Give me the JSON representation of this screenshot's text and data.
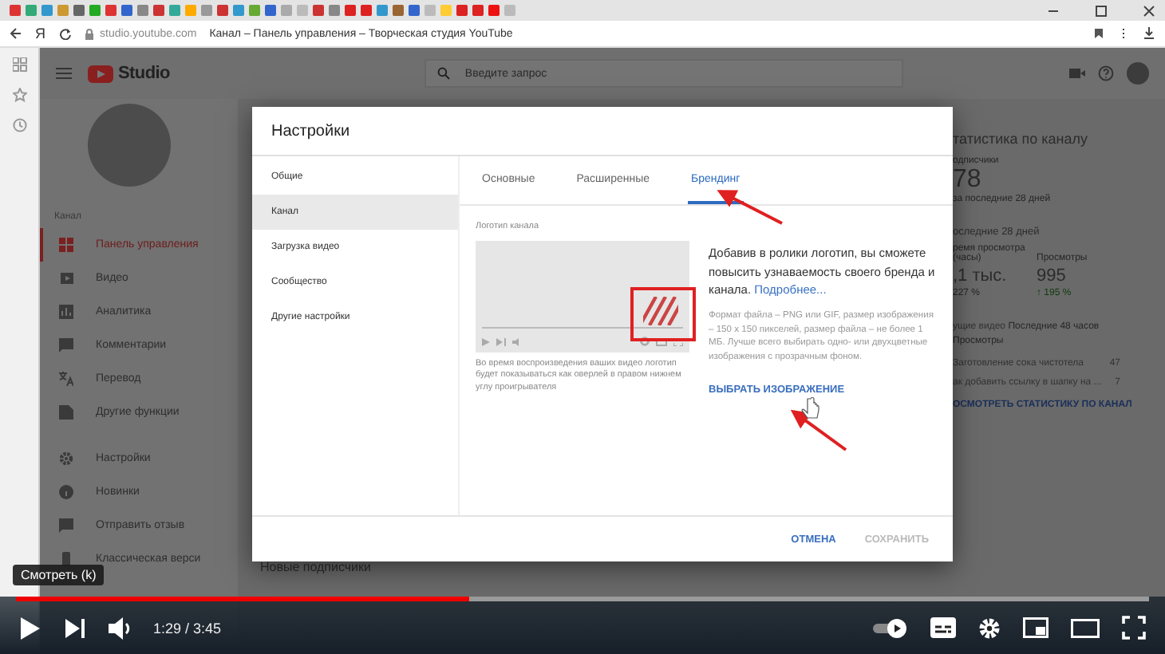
{
  "browser": {
    "logo": "Я",
    "url": "studio.youtube.com",
    "page_title": "Канал – Панель управления – Творческая студия YouTube"
  },
  "studio": {
    "logo_text": "Studio",
    "search": {
      "placeholder": "Введите запрос"
    },
    "nav_caption": "Канал",
    "nav": [
      {
        "label": "Панель управления",
        "selected": true
      },
      {
        "label": "Видео",
        "selected": false
      },
      {
        "label": "Аналитика",
        "selected": false
      },
      {
        "label": "Комментарии",
        "selected": false
      },
      {
        "label": "Перевод",
        "selected": false
      },
      {
        "label": "Другие функции",
        "selected": false
      }
    ],
    "nav_bottom": [
      {
        "label": "Настройки",
        "selected": false
      },
      {
        "label": "Новинки",
        "selected": false
      },
      {
        "label": "Отправить отзыв",
        "selected": false
      },
      {
        "label": "Классическая верси",
        "selected": false
      }
    ],
    "stats": {
      "title": "татистика по каналу",
      "subscribers_label": "одписчики",
      "subscribers": "78",
      "subscribers_note": "за последние 28 дней",
      "period": "оследние 28 дней",
      "watch_label": "ремя просмотра (часы)",
      "views_label": "Просмотры",
      "watch_value": ",1 тыс.",
      "views_value": "995",
      "watch_change": "227 %",
      "views_change": "↑ 195 %",
      "top_label": "ущие видео",
      "top_note": "Последние 48 часов",
      "top_sub": "Просмотры",
      "top_videos": [
        {
          "title": "Заготовление сока чистотела",
          "views": "47"
        },
        {
          "title": "ак добавить ссылку в шапку на ...",
          "views": "7"
        }
      ],
      "link": "ОСМОТРЕТЬ СТАТИСТИКУ ПО КАНАЛ"
    },
    "section_heading": "Новые подписчики"
  },
  "dialog": {
    "title": "Настройки",
    "menu": [
      {
        "label": "Общие",
        "selected": false
      },
      {
        "label": "Канал",
        "selected": true
      },
      {
        "label": "Загрузка видео",
        "selected": false
      },
      {
        "label": "Сообщество",
        "selected": false
      },
      {
        "label": "Другие настройки",
        "selected": false
      }
    ],
    "tabs": [
      {
        "label": "Основные",
        "selected": false
      },
      {
        "label": "Расширенные",
        "selected": false
      },
      {
        "label": "Брендинг",
        "selected": true
      }
    ],
    "logo_label": "Логотип канала",
    "preview_caption": "Во время воспроизведения ваших видео логотип будет показываться как оверлей в правом нижнем углу проигрывателя",
    "intro": "Добавив в ролики логотип, вы сможете повысить узнаваемость своего бренда и канала.",
    "intro_link": "Подробнее...",
    "format_note": "Формат файла – PNG или GIF, размер изображения – 150 x 150 пикселей, размер файла – не более 1 МБ. Лучше всего выбирать одно- или двухцветные изображения с прозрачным фоном.",
    "choose_link": "ВЫБРАТЬ ИЗОБРАЖЕНИЕ",
    "buttons": [
      {
        "label": "ОТМЕНА",
        "disabled": false
      },
      {
        "label": "СОХРАНИТЬ",
        "disabled": true
      }
    ]
  },
  "player": {
    "tooltip": "Смотреть (k)",
    "time": "1:29 / 3:45",
    "level": 0.4,
    "autoplay": true
  }
}
